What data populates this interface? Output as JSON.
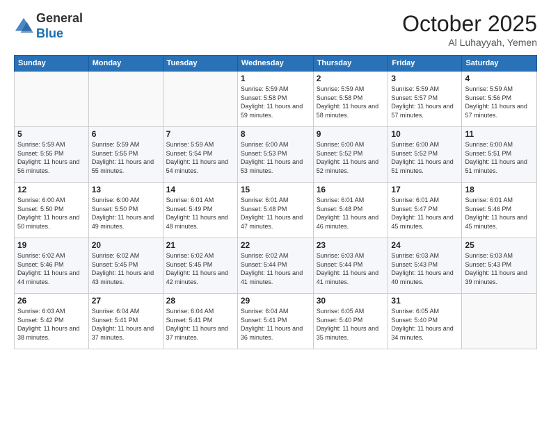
{
  "header": {
    "logo_general": "General",
    "logo_blue": "Blue",
    "month_title": "October 2025",
    "location": "Al Luhayyah, Yemen"
  },
  "weekdays": [
    "Sunday",
    "Monday",
    "Tuesday",
    "Wednesday",
    "Thursday",
    "Friday",
    "Saturday"
  ],
  "weeks": [
    [
      {
        "day": "",
        "sunrise": "",
        "sunset": "",
        "daylight": ""
      },
      {
        "day": "",
        "sunrise": "",
        "sunset": "",
        "daylight": ""
      },
      {
        "day": "",
        "sunrise": "",
        "sunset": "",
        "daylight": ""
      },
      {
        "day": "1",
        "sunrise": "Sunrise: 5:59 AM",
        "sunset": "Sunset: 5:58 PM",
        "daylight": "Daylight: 11 hours and 59 minutes."
      },
      {
        "day": "2",
        "sunrise": "Sunrise: 5:59 AM",
        "sunset": "Sunset: 5:58 PM",
        "daylight": "Daylight: 11 hours and 58 minutes."
      },
      {
        "day": "3",
        "sunrise": "Sunrise: 5:59 AM",
        "sunset": "Sunset: 5:57 PM",
        "daylight": "Daylight: 11 hours and 57 minutes."
      },
      {
        "day": "4",
        "sunrise": "Sunrise: 5:59 AM",
        "sunset": "Sunset: 5:56 PM",
        "daylight": "Daylight: 11 hours and 57 minutes."
      }
    ],
    [
      {
        "day": "5",
        "sunrise": "Sunrise: 5:59 AM",
        "sunset": "Sunset: 5:55 PM",
        "daylight": "Daylight: 11 hours and 56 minutes."
      },
      {
        "day": "6",
        "sunrise": "Sunrise: 5:59 AM",
        "sunset": "Sunset: 5:55 PM",
        "daylight": "Daylight: 11 hours and 55 minutes."
      },
      {
        "day": "7",
        "sunrise": "Sunrise: 5:59 AM",
        "sunset": "Sunset: 5:54 PM",
        "daylight": "Daylight: 11 hours and 54 minutes."
      },
      {
        "day": "8",
        "sunrise": "Sunrise: 6:00 AM",
        "sunset": "Sunset: 5:53 PM",
        "daylight": "Daylight: 11 hours and 53 minutes."
      },
      {
        "day": "9",
        "sunrise": "Sunrise: 6:00 AM",
        "sunset": "Sunset: 5:52 PM",
        "daylight": "Daylight: 11 hours and 52 minutes."
      },
      {
        "day": "10",
        "sunrise": "Sunrise: 6:00 AM",
        "sunset": "Sunset: 5:52 PM",
        "daylight": "Daylight: 11 hours and 51 minutes."
      },
      {
        "day": "11",
        "sunrise": "Sunrise: 6:00 AM",
        "sunset": "Sunset: 5:51 PM",
        "daylight": "Daylight: 11 hours and 51 minutes."
      }
    ],
    [
      {
        "day": "12",
        "sunrise": "Sunrise: 6:00 AM",
        "sunset": "Sunset: 5:50 PM",
        "daylight": "Daylight: 11 hours and 50 minutes."
      },
      {
        "day": "13",
        "sunrise": "Sunrise: 6:00 AM",
        "sunset": "Sunset: 5:50 PM",
        "daylight": "Daylight: 11 hours and 49 minutes."
      },
      {
        "day": "14",
        "sunrise": "Sunrise: 6:01 AM",
        "sunset": "Sunset: 5:49 PM",
        "daylight": "Daylight: 11 hours and 48 minutes."
      },
      {
        "day": "15",
        "sunrise": "Sunrise: 6:01 AM",
        "sunset": "Sunset: 5:48 PM",
        "daylight": "Daylight: 11 hours and 47 minutes."
      },
      {
        "day": "16",
        "sunrise": "Sunrise: 6:01 AM",
        "sunset": "Sunset: 5:48 PM",
        "daylight": "Daylight: 11 hours and 46 minutes."
      },
      {
        "day": "17",
        "sunrise": "Sunrise: 6:01 AM",
        "sunset": "Sunset: 5:47 PM",
        "daylight": "Daylight: 11 hours and 45 minutes."
      },
      {
        "day": "18",
        "sunrise": "Sunrise: 6:01 AM",
        "sunset": "Sunset: 5:46 PM",
        "daylight": "Daylight: 11 hours and 45 minutes."
      }
    ],
    [
      {
        "day": "19",
        "sunrise": "Sunrise: 6:02 AM",
        "sunset": "Sunset: 5:46 PM",
        "daylight": "Daylight: 11 hours and 44 minutes."
      },
      {
        "day": "20",
        "sunrise": "Sunrise: 6:02 AM",
        "sunset": "Sunset: 5:45 PM",
        "daylight": "Daylight: 11 hours and 43 minutes."
      },
      {
        "day": "21",
        "sunrise": "Sunrise: 6:02 AM",
        "sunset": "Sunset: 5:45 PM",
        "daylight": "Daylight: 11 hours and 42 minutes."
      },
      {
        "day": "22",
        "sunrise": "Sunrise: 6:02 AM",
        "sunset": "Sunset: 5:44 PM",
        "daylight": "Daylight: 11 hours and 41 minutes."
      },
      {
        "day": "23",
        "sunrise": "Sunrise: 6:03 AM",
        "sunset": "Sunset: 5:44 PM",
        "daylight": "Daylight: 11 hours and 41 minutes."
      },
      {
        "day": "24",
        "sunrise": "Sunrise: 6:03 AM",
        "sunset": "Sunset: 5:43 PM",
        "daylight": "Daylight: 11 hours and 40 minutes."
      },
      {
        "day": "25",
        "sunrise": "Sunrise: 6:03 AM",
        "sunset": "Sunset: 5:43 PM",
        "daylight": "Daylight: 11 hours and 39 minutes."
      }
    ],
    [
      {
        "day": "26",
        "sunrise": "Sunrise: 6:03 AM",
        "sunset": "Sunset: 5:42 PM",
        "daylight": "Daylight: 11 hours and 38 minutes."
      },
      {
        "day": "27",
        "sunrise": "Sunrise: 6:04 AM",
        "sunset": "Sunset: 5:41 PM",
        "daylight": "Daylight: 11 hours and 37 minutes."
      },
      {
        "day": "28",
        "sunrise": "Sunrise: 6:04 AM",
        "sunset": "Sunset: 5:41 PM",
        "daylight": "Daylight: 11 hours and 37 minutes."
      },
      {
        "day": "29",
        "sunrise": "Sunrise: 6:04 AM",
        "sunset": "Sunset: 5:41 PM",
        "daylight": "Daylight: 11 hours and 36 minutes."
      },
      {
        "day": "30",
        "sunrise": "Sunrise: 6:05 AM",
        "sunset": "Sunset: 5:40 PM",
        "daylight": "Daylight: 11 hours and 35 minutes."
      },
      {
        "day": "31",
        "sunrise": "Sunrise: 6:05 AM",
        "sunset": "Sunset: 5:40 PM",
        "daylight": "Daylight: 11 hours and 34 minutes."
      },
      {
        "day": "",
        "sunrise": "",
        "sunset": "",
        "daylight": ""
      }
    ]
  ]
}
